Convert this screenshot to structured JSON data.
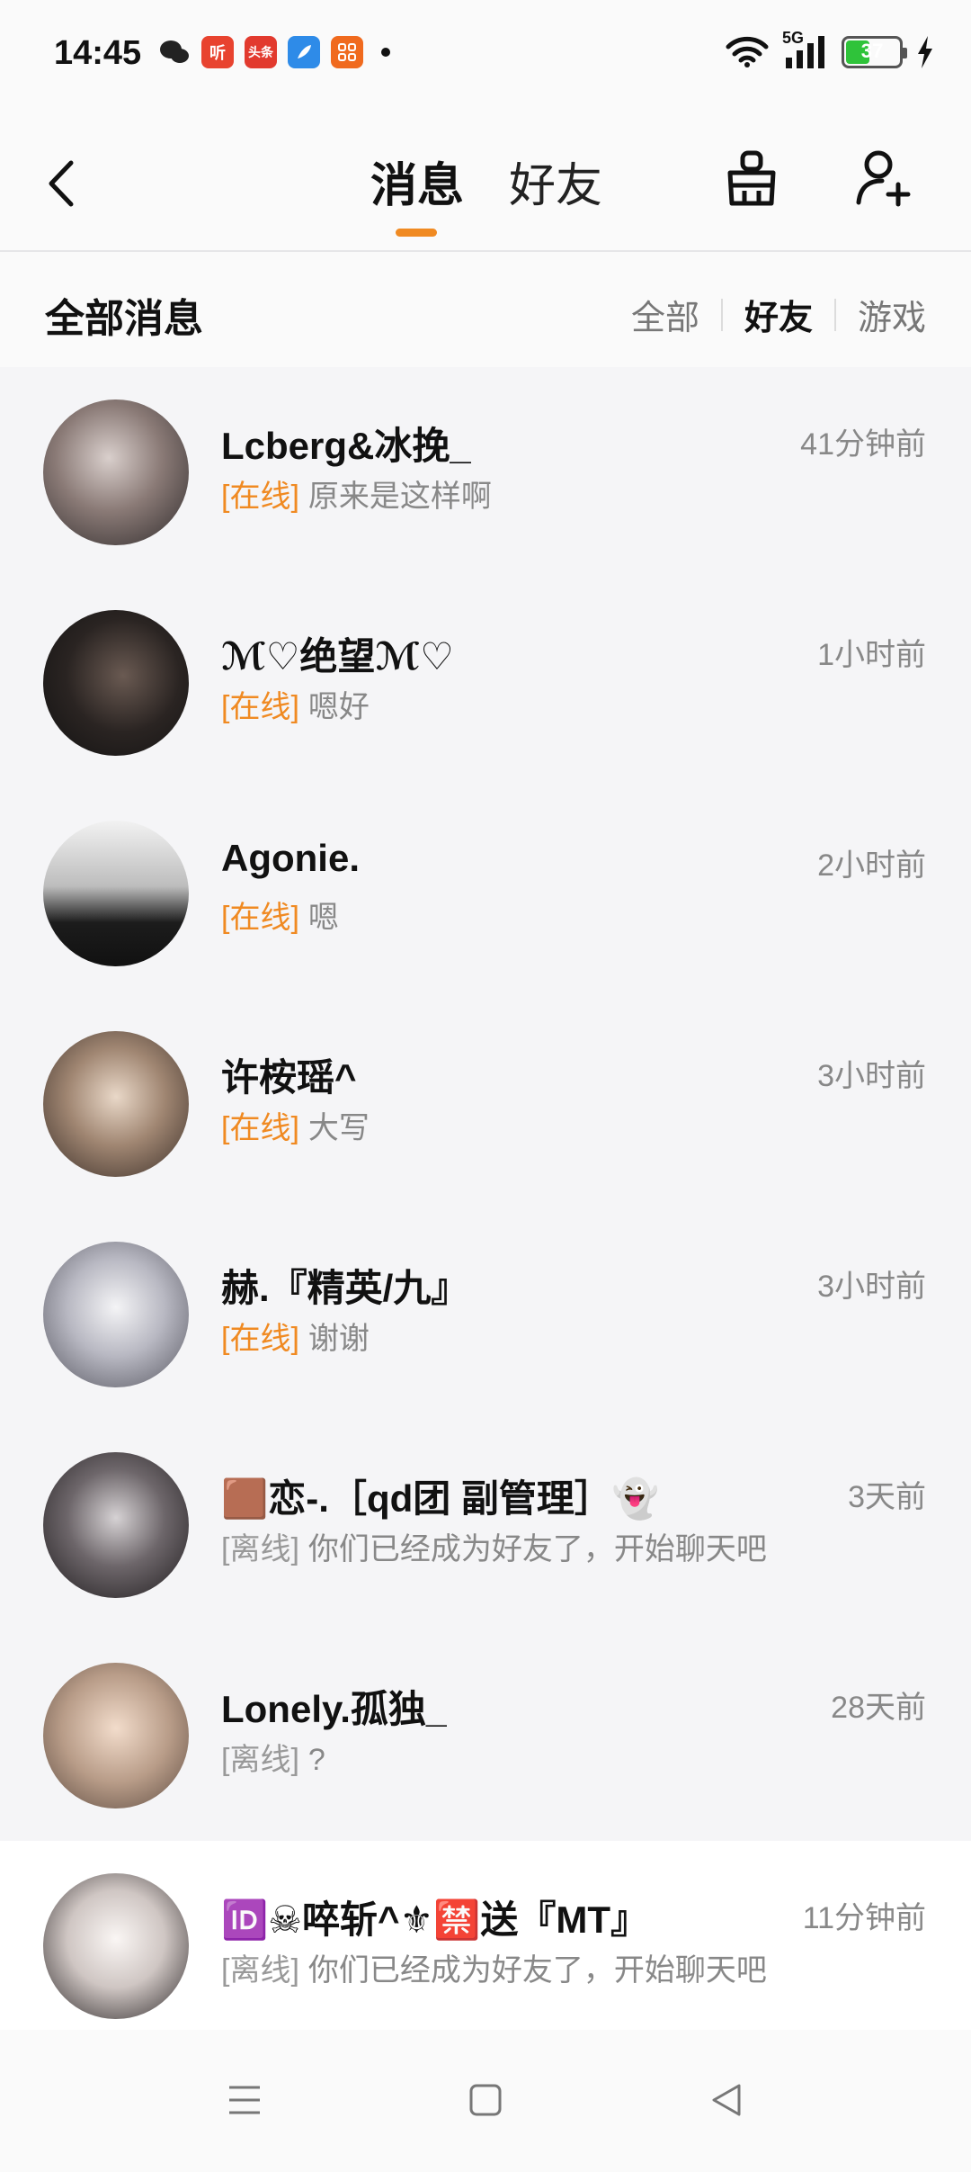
{
  "status_bar": {
    "time": "14:45",
    "network": "5G",
    "battery": "37",
    "battery_level_pct": 37,
    "notification_icons": [
      "wechat-icon",
      "ting-icon",
      "toutiao-icon",
      "feather-icon",
      "grid-app-icon"
    ]
  },
  "header": {
    "tabs": [
      {
        "label": "消息",
        "active": true
      },
      {
        "label": "好友",
        "active": false
      }
    ]
  },
  "filter": {
    "title": "全部消息",
    "tabs": [
      {
        "label": "全部",
        "active": false
      },
      {
        "label": "好友",
        "active": true
      },
      {
        "label": "游戏",
        "active": false
      }
    ]
  },
  "conversations": [
    {
      "name": "Lcberg&冰挽_",
      "time": "41分钟前",
      "status": "[在线]",
      "online": true,
      "message": "原来是这样啊",
      "avatar_color": "#6b5a55"
    },
    {
      "name": "ℳ♡绝望ℳ♡",
      "time": "1小时前",
      "status": "[在线]",
      "online": true,
      "message": "嗯好",
      "avatar_color": "#2b2624"
    },
    {
      "name": "Agonie.",
      "time": "2小时前",
      "status": "[在线]",
      "online": true,
      "message": "嗯",
      "avatar_color": "#9a9a9a"
    },
    {
      "name": "许桉瑶^",
      "time": "3小时前",
      "status": "[在线]",
      "online": true,
      "message": "大写",
      "avatar_color": "#8a7261"
    },
    {
      "name": "赫.『精英/九』",
      "time": "3小时前",
      "status": "[在线]",
      "online": true,
      "message": "谢谢",
      "avatar_color": "#c4c4cc"
    },
    {
      "name": "🟫恋-.［qd团 副管理］👻",
      "time": "3天前",
      "status": "[离线]",
      "online": false,
      "message": "你们已经成为好友了，开始聊天吧",
      "avatar_color": "#4a4548"
    },
    {
      "name": "Lonely.孤独_",
      "time": "28天前",
      "status": "[离线]",
      "online": false,
      "message": "?",
      "avatar_color": "#b49c8a"
    },
    {
      "name": "🆔☠啐斩^⚜🈲送『MT』",
      "time": "11分钟前",
      "status": "[离线]",
      "online": false,
      "message": "你们已经成为好友了，开始聊天吧",
      "avatar_color": "#d8d2d0"
    }
  ]
}
